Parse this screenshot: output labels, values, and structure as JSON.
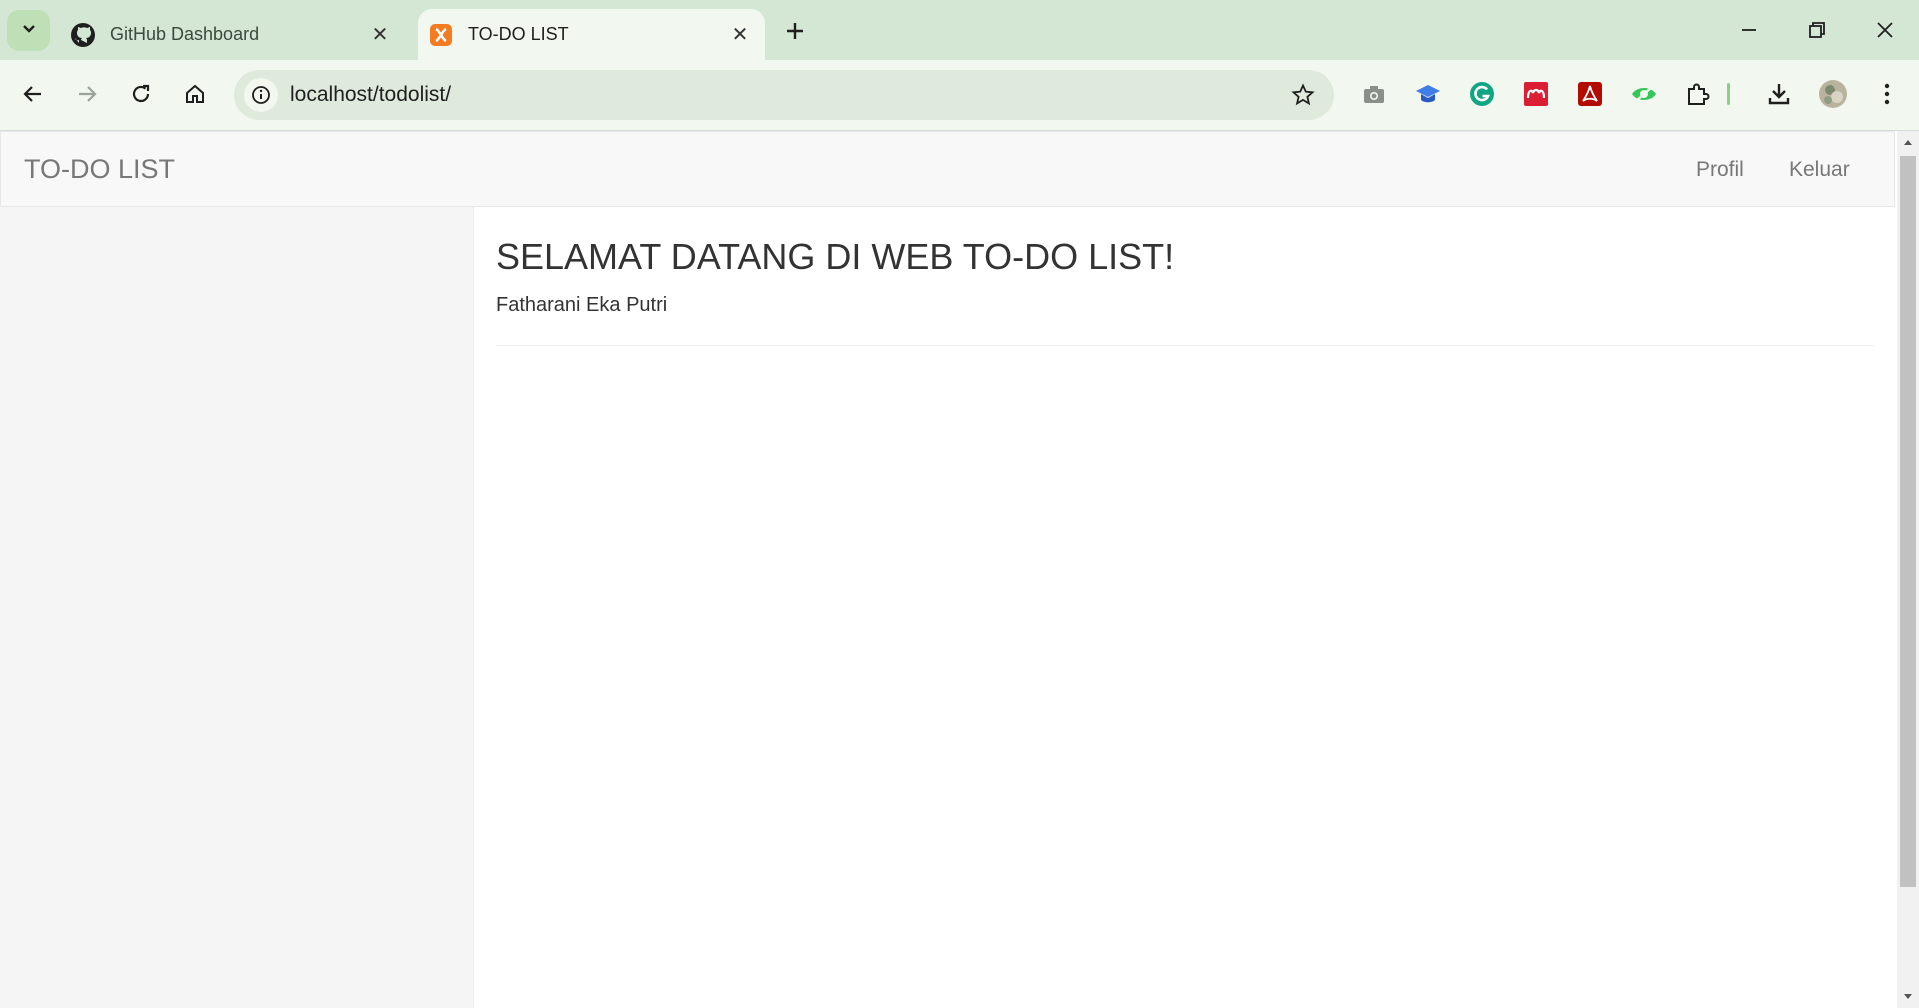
{
  "browser": {
    "tabs": [
      {
        "label": "GitHub Dashboard",
        "favicon": "github-icon",
        "active": false
      },
      {
        "label": "TO-DO LIST",
        "favicon": "xampp-icon",
        "active": true
      }
    ],
    "address": "localhost/todolist/",
    "extensions": [
      "camera-icon",
      "mortarboard-icon",
      "grammarly-icon",
      "mendeley-icon",
      "acrobat-icon",
      "eye-extension-icon",
      "puzzle-icon"
    ],
    "colors": {
      "tabstrip": "#d4e6d4",
      "toolbar": "#f2f7ef",
      "omnibox": "#dfe9dc"
    }
  },
  "navbar": {
    "brand": "TO-DO LIST",
    "links": [
      "Profil",
      "Keluar"
    ]
  },
  "main": {
    "heading": "SELAMAT DATANG DI WEB TO-DO LIST!",
    "subtitle": "Fatharani Eka Putri"
  }
}
